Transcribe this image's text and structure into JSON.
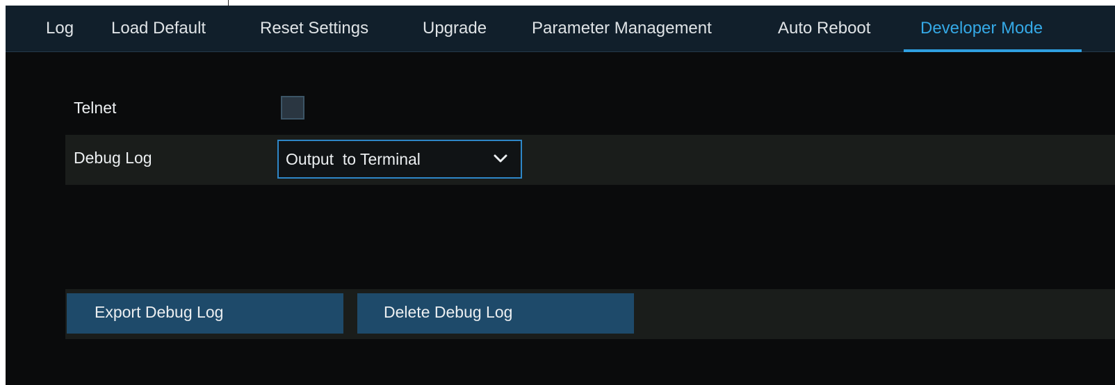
{
  "tabs": [
    {
      "label": "Log"
    },
    {
      "label": "Load Default"
    },
    {
      "label": "Reset Settings"
    },
    {
      "label": "Upgrade"
    },
    {
      "label": "Parameter Management"
    },
    {
      "label": "Auto Reboot"
    },
    {
      "label": "Developer Mode",
      "active": true
    }
  ],
  "settings": {
    "telnet": {
      "label": "Telnet",
      "checked": false
    },
    "debug_log": {
      "label": "Debug Log",
      "value": "Output  to Terminal"
    }
  },
  "buttons": {
    "export": "Export Debug Log",
    "delete": "Delete Debug Log"
  },
  "colors": {
    "accent": "#35a9e6",
    "tab_bar": "#111f2b",
    "background": "#0a0b0c",
    "button": "#1e4a6a"
  },
  "icons": {
    "dropdown": "chevron-down-icon"
  }
}
